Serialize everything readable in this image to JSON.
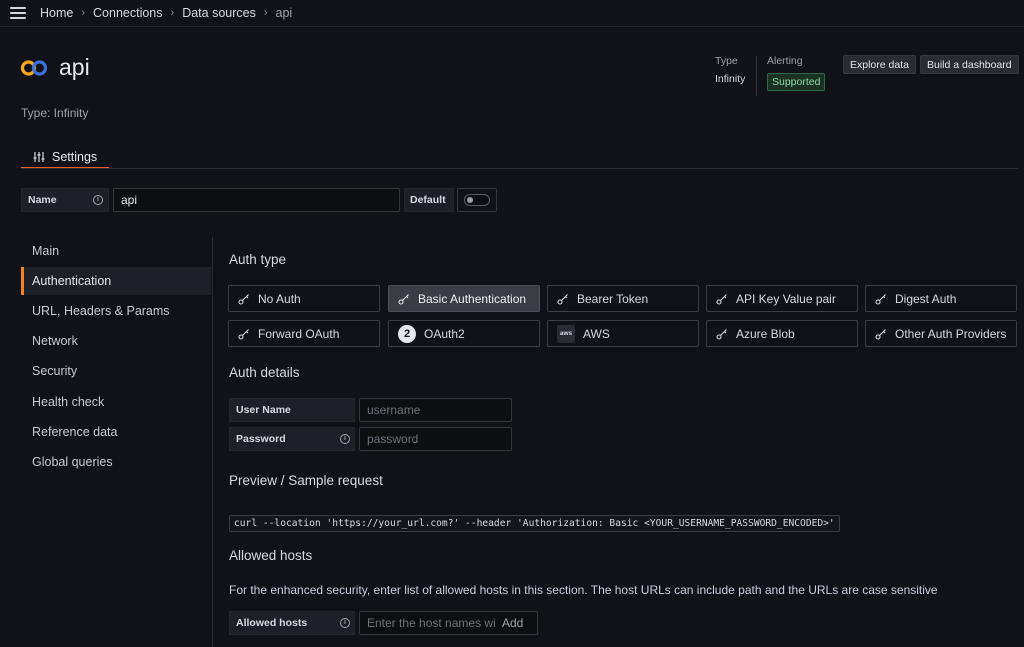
{
  "breadcrumbs": [
    "Home",
    "Connections",
    "Data sources",
    "api"
  ],
  "header": {
    "title": "api",
    "type_text": "Type: Infinity",
    "meta_type_label": "Type",
    "meta_type_value": "Infinity",
    "meta_alerting_label": "Alerting",
    "meta_alerting_value": "Supported",
    "explore_label": "Explore data",
    "dashboard_label": "Build a dashboard"
  },
  "tabs": [
    {
      "label": "Settings"
    }
  ],
  "name_row": {
    "label": "Name",
    "value": "api",
    "default_label": "Default",
    "default_on": false
  },
  "sidebar": {
    "items": [
      {
        "label": "Main"
      },
      {
        "label": "Authentication"
      },
      {
        "label": "URL, Headers & Params"
      },
      {
        "label": "Network"
      },
      {
        "label": "Security"
      },
      {
        "label": "Health check"
      },
      {
        "label": "Reference data"
      },
      {
        "label": "Global queries"
      }
    ],
    "active": "Authentication"
  },
  "auth": {
    "title": "Auth type",
    "options": [
      {
        "label": "No Auth",
        "icon": "key-icon"
      },
      {
        "label": "Basic Authentication",
        "icon": "key-icon"
      },
      {
        "label": "Bearer Token",
        "icon": "key-icon"
      },
      {
        "label": "API Key Value pair",
        "icon": "key-icon"
      },
      {
        "label": "Digest Auth",
        "icon": "key-icon"
      },
      {
        "label": "Forward OAuth",
        "icon": "key-icon"
      },
      {
        "label": "OAuth2",
        "icon": "oauth2-icon"
      },
      {
        "label": "AWS",
        "icon": "aws-icon"
      },
      {
        "label": "Azure Blob",
        "icon": "key-icon"
      },
      {
        "label": "Other Auth Providers",
        "icon": "key-icon"
      }
    ],
    "selected": "Basic Authentication",
    "aws_icon_text": "aws",
    "oauth2_icon_text": "2"
  },
  "details": {
    "title": "Auth details",
    "username_label": "User Name",
    "username_placeholder": "username",
    "password_label": "Password",
    "password_placeholder": "password"
  },
  "preview": {
    "title": "Preview / Sample request",
    "code": "curl --location 'https://your_url.com?' --header 'Authorization: Basic <YOUR_USERNAME_PASSWORD_ENCODED>'"
  },
  "hosts": {
    "title": "Allowed hosts",
    "description": "For the enhanced security, enter list of allowed hosts in this section. The host URLs can include path and the URLs are case sensitive",
    "label": "Allowed hosts",
    "placeholder": "Enter the host names wi",
    "add_label": "Add"
  },
  "colors": {
    "accent": "#f05a28",
    "badge_green": "#8fd5a6",
    "background": "#111217"
  }
}
